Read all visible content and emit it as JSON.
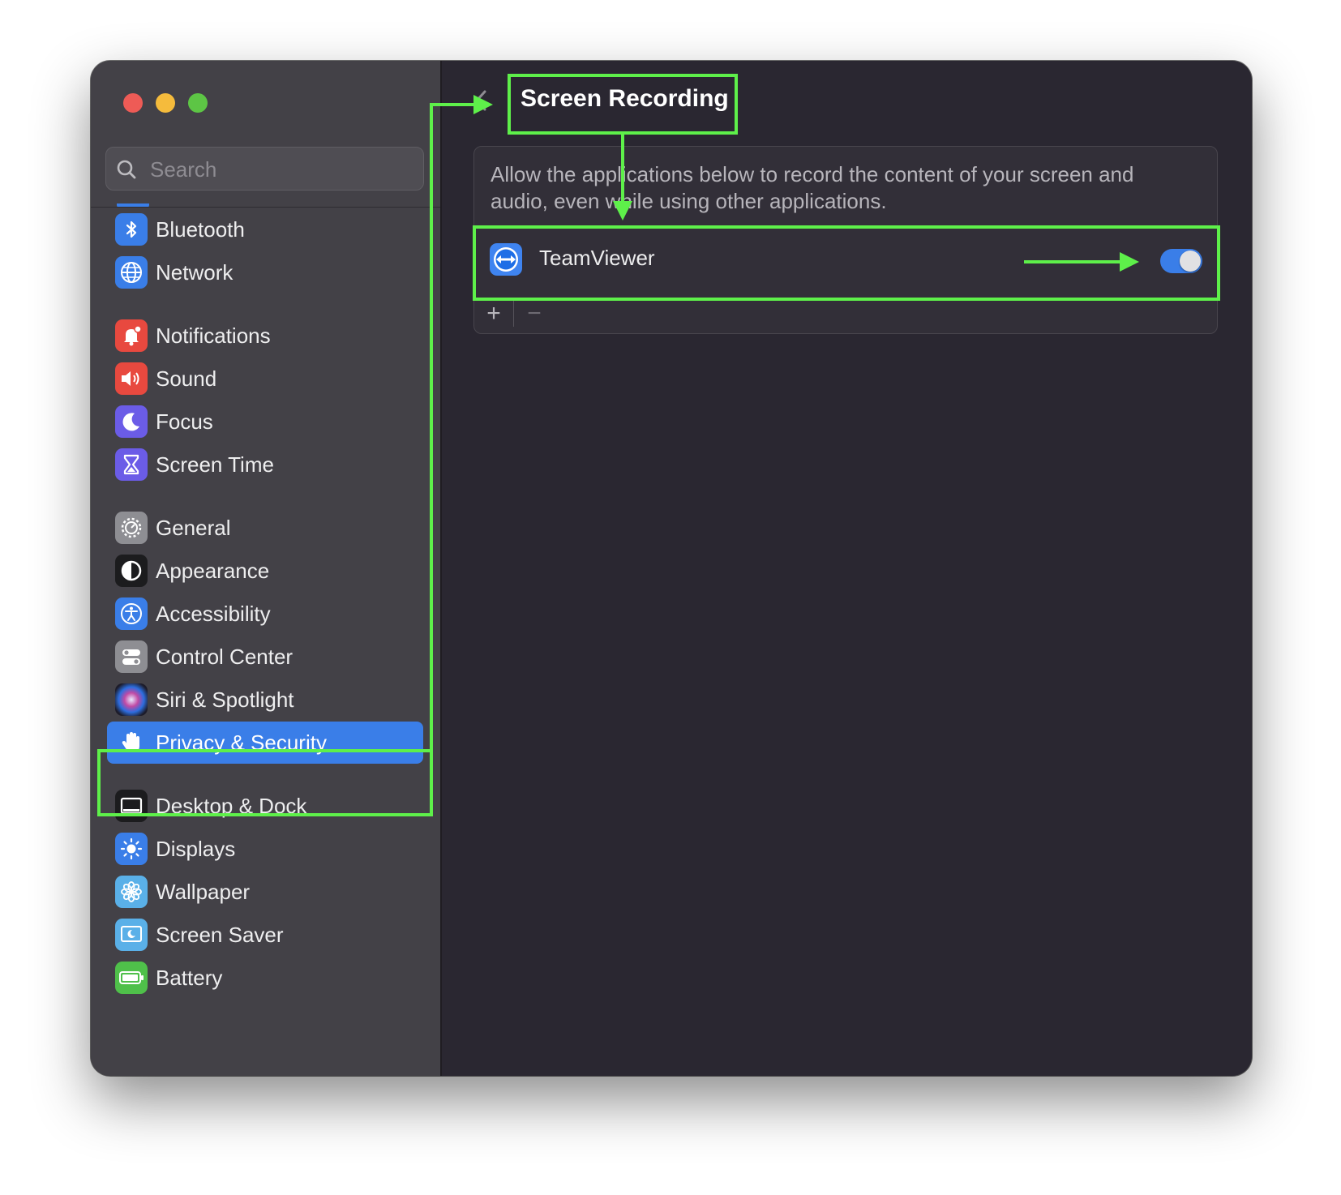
{
  "window": {
    "controls": [
      "close",
      "minimize",
      "zoom"
    ]
  },
  "search": {
    "placeholder": "Search"
  },
  "sidebar": {
    "items": [
      {
        "label": "Bluetooth",
        "icon": "bluetooth-icon",
        "color": "#3a7ee8"
      },
      {
        "label": "Network",
        "icon": "globe-icon",
        "color": "#3a7ee8"
      },
      {
        "label": "Notifications",
        "icon": "bell-icon",
        "color": "#e8493f"
      },
      {
        "label": "Sound",
        "icon": "speaker-icon",
        "color": "#e8493f"
      },
      {
        "label": "Focus",
        "icon": "moon-icon",
        "color": "#6b5ce7"
      },
      {
        "label": "Screen Time",
        "icon": "hourglass-icon",
        "color": "#6b5ce7"
      },
      {
        "label": "General",
        "icon": "gear-icon",
        "color": "#8e8e93"
      },
      {
        "label": "Appearance",
        "icon": "appearance-icon",
        "color": "#1c1c1e"
      },
      {
        "label": "Accessibility",
        "icon": "accessibility-icon",
        "color": "#3a7ee8"
      },
      {
        "label": "Control Center",
        "icon": "toggles-icon",
        "color": "#8e8e93"
      },
      {
        "label": "Siri & Spotlight",
        "icon": "siri-icon",
        "color": "#2b2b3a"
      },
      {
        "label": "Privacy & Security",
        "icon": "hand-icon",
        "color": "#3a7ee8",
        "selected": true
      },
      {
        "label": "Desktop & Dock",
        "icon": "dock-icon",
        "color": "#1c1c1e"
      },
      {
        "label": "Displays",
        "icon": "sun-icon",
        "color": "#3a7ee8"
      },
      {
        "label": "Wallpaper",
        "icon": "flower-icon",
        "color": "#5ab0e8"
      },
      {
        "label": "Screen Saver",
        "icon": "screensaver-icon",
        "color": "#5ab0e8"
      },
      {
        "label": "Battery",
        "icon": "battery-icon",
        "color": "#4fc04a"
      }
    ]
  },
  "main": {
    "title": "Screen Recording",
    "description": "Allow the applications below to record the content of your screen and audio, even while using other applications.",
    "apps": [
      {
        "name": "TeamViewer",
        "icon": "teamviewer-icon",
        "enabled": true
      }
    ],
    "add_label": "+",
    "remove_label": "−"
  },
  "colors": {
    "accent": "#3a7ee8",
    "annotation": "#5ef04a"
  }
}
